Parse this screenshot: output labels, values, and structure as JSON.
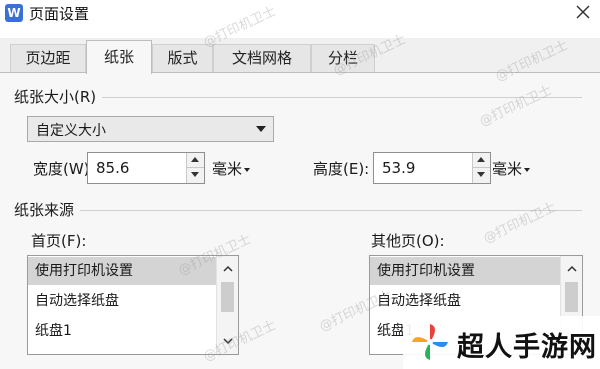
{
  "window": {
    "app_icon_letter": "W",
    "title": "页面设置"
  },
  "tabs": [
    {
      "label": "页边距",
      "active": false
    },
    {
      "label": "纸张",
      "active": true
    },
    {
      "label": "版式",
      "active": false
    },
    {
      "label": "文档网格",
      "active": false
    },
    {
      "label": "分栏",
      "active": false
    }
  ],
  "paper_size": {
    "section_label": "纸张大小(R)",
    "selected": "自定义大小",
    "width_label": "宽度(W):",
    "width_value": "85.6",
    "width_unit": "毫米",
    "height_label": "高度(E):",
    "height_value": "53.9",
    "height_unit": "毫米"
  },
  "paper_source": {
    "section_label": "纸张来源",
    "first_page_label": "首页(F):",
    "first_page_items": [
      "使用打印机设置",
      "自动选择纸盘",
      "纸盘1"
    ],
    "other_pages_label": "其他页(O):",
    "other_pages_items": [
      "使用打印机设置",
      "自动选择纸盘",
      "纸盘1"
    ]
  },
  "watermark_text": "@打印机卫士",
  "brand": {
    "name": "超人手游网",
    "logo_colors": [
      "#e8423f",
      "#2d8cf0",
      "#27b35a",
      "#f5a623"
    ]
  },
  "colors": {
    "accent": "#3b6fd8",
    "panel_bg": "#f7f7f7",
    "selected_row": "#d4d4d4"
  }
}
